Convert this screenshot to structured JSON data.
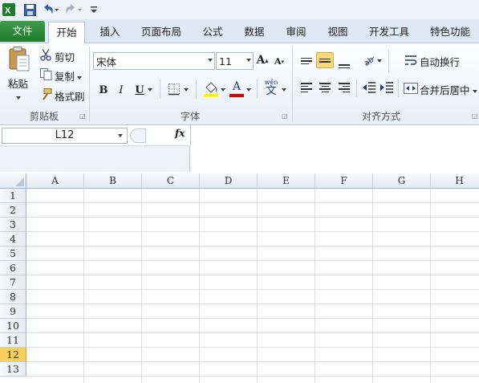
{
  "quick_access": {
    "icons": [
      "excel-logo-icon",
      "save-icon",
      "undo-icon",
      "redo-icon",
      "customize-icon"
    ]
  },
  "tabs": [
    {
      "label": "文件"
    },
    {
      "label": "开始"
    },
    {
      "label": "插入"
    },
    {
      "label": "页面布局"
    },
    {
      "label": "公式"
    },
    {
      "label": "数据"
    },
    {
      "label": "审阅"
    },
    {
      "label": "视图"
    },
    {
      "label": "开发工具"
    },
    {
      "label": "特色功能"
    }
  ],
  "clipboard": {
    "paste": "粘贴",
    "cut": "剪切",
    "copy": "复制",
    "format_painter": "格式刷",
    "group": "剪贴板"
  },
  "font": {
    "name": "宋体",
    "size": "11",
    "bold": "B",
    "italic": "I",
    "underline": "U",
    "font_color_letter": "A",
    "phonetic": "wén",
    "phonetic_char": "文",
    "group": "字体"
  },
  "alignment": {
    "wrap_text": "自动换行",
    "merge_center": "合并后居中",
    "group": "对齐方式"
  },
  "formula_bar": {
    "name_box": "L12",
    "fx": "fx"
  },
  "grid": {
    "columns": [
      "A",
      "B",
      "C",
      "D",
      "E",
      "F",
      "G",
      "H"
    ],
    "rows": [
      "1",
      "2",
      "3",
      "4",
      "5",
      "6",
      "7",
      "8",
      "9",
      "10",
      "11",
      "12",
      "13"
    ],
    "active_row": "12"
  },
  "colors": {
    "file_tab": "#2a8a36",
    "active_row_header": "#f9cf59",
    "fill_yellow": "#ffff00",
    "font_red": "#e00000"
  }
}
